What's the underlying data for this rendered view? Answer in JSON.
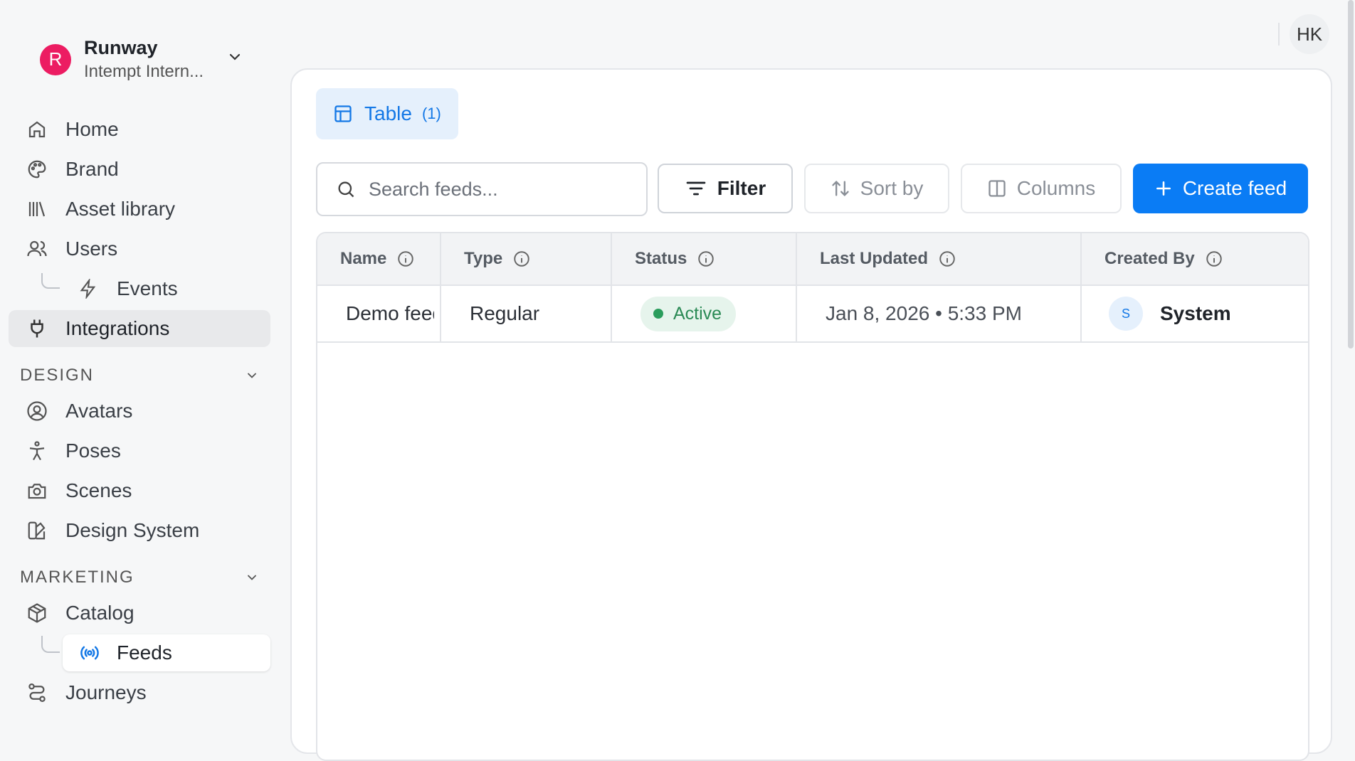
{
  "workspace": {
    "initial": "R",
    "name": "Runway",
    "subtitle": "Intempt Intern...",
    "logo_color": "#ec1c62"
  },
  "nav": {
    "home": "Home",
    "brand": "Brand",
    "asset_library": "Asset library",
    "users": "Users",
    "events": "Events",
    "integrations": "Integrations",
    "design_section": "DESIGN",
    "avatars": "Avatars",
    "poses": "Poses",
    "scenes": "Scenes",
    "design_system": "Design System",
    "marketing_section": "MARKETING",
    "catalog": "Catalog",
    "feeds": "Feeds",
    "journeys": "Journeys"
  },
  "user": {
    "initials": "HK"
  },
  "view_tab": {
    "label": "Table",
    "count": "(1)"
  },
  "search": {
    "placeholder": "Search feeds..."
  },
  "toolbar": {
    "filter": "Filter",
    "sort": "Sort by",
    "columns": "Columns",
    "create": "Create feed"
  },
  "table": {
    "headers": {
      "name": "Name",
      "type": "Type",
      "status": "Status",
      "last_updated": "Last Updated",
      "created_by": "Created By"
    },
    "rows": [
      {
        "name": "Demo feed",
        "type": "Regular",
        "status": "Active",
        "last_updated": "Jan 8, 2026 • 5:33 PM",
        "creator_initial": "S",
        "created_by": "System"
      }
    ]
  },
  "colors": {
    "accent": "#0a7cf5",
    "status_active": "#2a9d5c"
  }
}
